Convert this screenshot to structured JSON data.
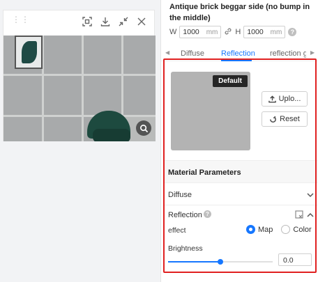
{
  "preview": {
    "toolbar_icons": [
      "screenshot-icon",
      "download-icon",
      "collapse-icon",
      "close-icon"
    ],
    "zoom_icon": "magnifier-icon"
  },
  "material": {
    "title": "Antique brick beggar side (no bump in the middle)",
    "width_label": "W",
    "width_value": "1000",
    "width_unit": "mm",
    "height_label": "H",
    "height_value": "1000",
    "height_unit": "mm"
  },
  "tabs": [
    {
      "label": "Diffuse",
      "active": false
    },
    {
      "label": "Reflection",
      "active": true
    },
    {
      "label": "reflection gl",
      "active": false
    }
  ],
  "texture": {
    "default_badge": "Default",
    "upload_label": "Uplo...",
    "reset_label": "Reset"
  },
  "params": {
    "section_title": "Material Parameters",
    "diffuse_label": "Diffuse",
    "reflection_label": "Reflection",
    "effect_label": "effect",
    "option_map": "Map",
    "option_color": "Color",
    "selected_option": "Map",
    "brightness_label": "Brightness",
    "brightness_value": "0.0",
    "brightness_slider_fraction": 0.5
  },
  "colors": {
    "accent": "#1677ff",
    "highlight_border": "#e02020"
  }
}
